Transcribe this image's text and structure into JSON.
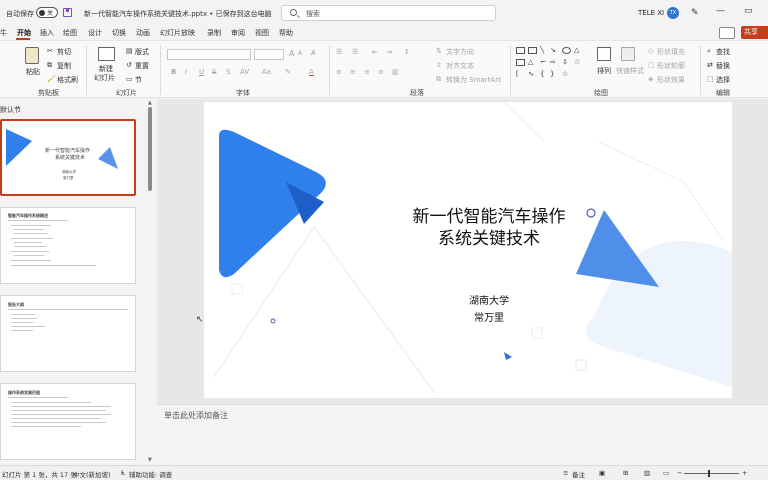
{
  "titlebar": {
    "autosave_label": "自动保存",
    "autosave_state": "关",
    "doc_title": "新一代智能汽车操作系统关键技术.pptx • 已保存到这台电脑",
    "search_placeholder": "搜索",
    "user_name": "TELE XI",
    "user_initials": "TX"
  },
  "menu": {
    "tabs": [
      "开始",
      "插入",
      "绘图",
      "设计",
      "切换",
      "动画",
      "幻灯片放映",
      "录制",
      "审阅",
      "视图",
      "帮助"
    ],
    "active_tab": "开始",
    "share_label": "共享"
  },
  "ribbon": {
    "clipboard": {
      "paste": "粘贴",
      "cut": "剪切",
      "copy": "复制",
      "format_painter": "格式刷",
      "label": "剪贴板"
    },
    "slides": {
      "new_slide": "新建",
      "new_slide2": "幻灯片",
      "layout": "版式",
      "reset": "重置",
      "section": "节",
      "label": "幻灯片"
    },
    "font": {
      "label": "字体",
      "bold": "B",
      "italic": "I",
      "underline": "U",
      "strike": "S",
      "grow": "A",
      "shrink": "A"
    },
    "paragraph": {
      "label": "段落",
      "text_direction": "文字方向",
      "align_text": "对齐文本",
      "smartart": "转换为 SmartArt"
    },
    "drawing": {
      "label": "绘图",
      "arrange": "排列",
      "quick_styles": "快速样式",
      "shape_fill": "形状填充",
      "shape_outline": "形状轮廓",
      "shape_effects": "形状效果"
    },
    "editing": {
      "label": "编辑",
      "find": "查找",
      "replace": "替换",
      "select": "选择"
    }
  },
  "left_panel": {
    "section_label": "默认节",
    "thumb1": {
      "title_l1": "新一代智能汽车操作",
      "title_l2": "系统关键技术",
      "sub1": "湖南大学",
      "sub2": "常万里"
    },
    "thumb2": {
      "heading": "智能汽车操作系统概述"
    },
    "thumb3": {
      "heading": "报告大纲"
    },
    "thumb4": {
      "heading": "操作系统发展历程"
    }
  },
  "slide": {
    "title_line1": "新一代智能汽车操作",
    "title_line2": "系统关键技术",
    "affiliation": "湖南大学",
    "author": "常万里",
    "accent_color": "#2f80ed"
  },
  "notes": {
    "placeholder": "单击此处添加备注"
  },
  "statusbar": {
    "slide_count": "幻灯片 第 1 张，共 17 张",
    "language": "中文(新加坡)",
    "accessibility": "辅助功能: 调查",
    "notes_btn": "备注",
    "zoom_pct": 0.45
  }
}
